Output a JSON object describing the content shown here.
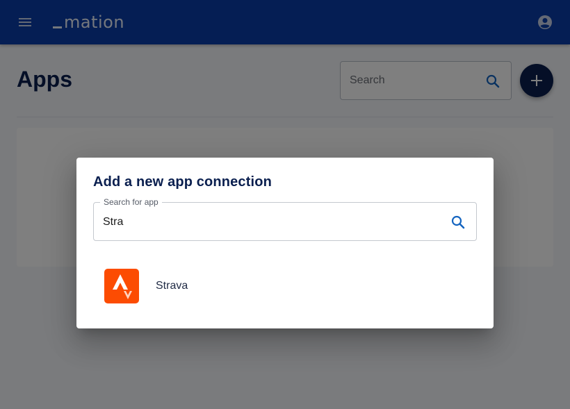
{
  "header": {
    "logo_text": "mation",
    "menu_icon": "menu-icon",
    "account_icon": "account-circle-icon",
    "bar_color": "#0a3da8"
  },
  "main": {
    "title": "Apps",
    "search": {
      "placeholder": "Search",
      "icon": "search-icon"
    },
    "add_button_icon": "plus-icon"
  },
  "dialog": {
    "title": "Add a new app connection",
    "search_field": {
      "label": "Search for app",
      "value": "Stra",
      "icon": "search-icon",
      "accent_color": "#1565c0"
    },
    "results": [
      {
        "name": "Strava",
        "icon": "strava-logo",
        "brand_color": "#fc4c02"
      }
    ]
  }
}
